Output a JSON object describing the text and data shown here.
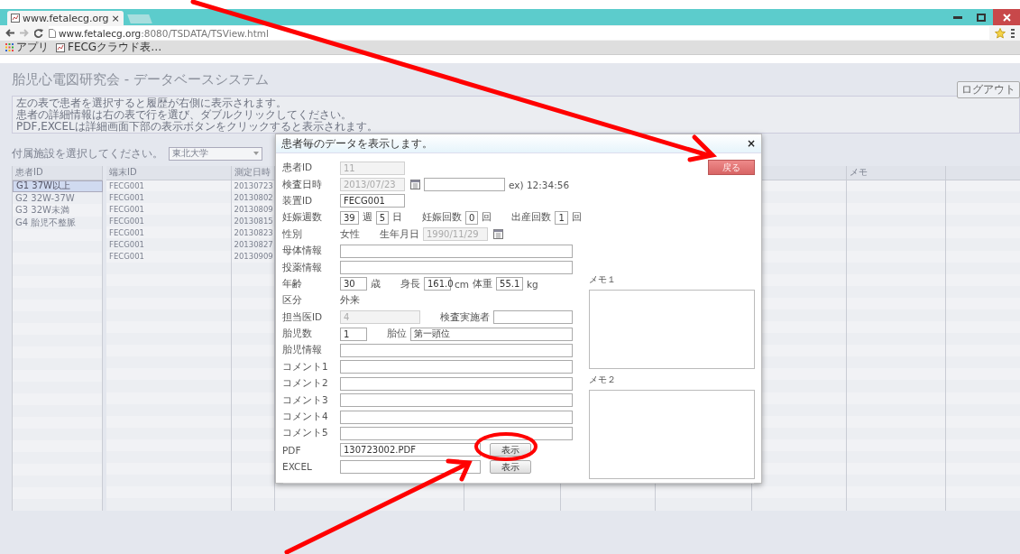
{
  "browser": {
    "tab_title": "www.fetalecg.org",
    "tab_close": "×",
    "url_host": "www.fetalecg.org",
    "url_path": ":8080/TSDATA/TSView.html",
    "bookmarks": [
      "アプリ",
      "FECGクラウド表…"
    ]
  },
  "page": {
    "title": "胎児心電図研究会 - データベースシステム",
    "logout": "ログアウト",
    "info_lines": [
      "左の表で患者を選択すると履歴が右側に表示されます。",
      "患者の詳細情報は右の表で行を選び、ダブルクリックしてください。",
      "PDF,EXCELは詳細画面下部の表示ボタンをクリックすると表示されます。"
    ],
    "facility_label": "付属施設を選択してください。",
    "facility_value": "東北大学",
    "patients": {
      "column": "患者ID",
      "rows": [
        {
          "label": "G1 37W以上",
          "selected": true
        },
        {
          "label": "G2 32W-37W",
          "selected": false
        },
        {
          "label": "G3 32W未満",
          "selected": false
        },
        {
          "label": "G4 胎児不整脈",
          "selected": false
        }
      ]
    },
    "records": {
      "columns": [
        "端末ID",
        "測定日時"
      ],
      "last_column": "メモ",
      "rows": [
        [
          "FECG001",
          "20130723"
        ],
        [
          "FECG001",
          "20130802"
        ],
        [
          "FECG001",
          "20130809"
        ],
        [
          "FECG001",
          "20130815"
        ],
        [
          "FECG001",
          "20130823"
        ],
        [
          "FECG001",
          "20130827"
        ],
        [
          "FECG001",
          "20130909"
        ]
      ]
    }
  },
  "dialog": {
    "title": "患者毎のデータを表示します。",
    "close": "×",
    "back_button": "戻る",
    "rows": [
      {
        "label": "患者ID",
        "parts": [
          {
            "kind": "medium",
            "value": "11",
            "disabled": true
          }
        ]
      },
      {
        "label": "検査日時",
        "parts": [
          {
            "kind": "medium",
            "value": "2013/07/23",
            "disabled": true
          },
          {
            "kind": "calendar"
          },
          {
            "kind": "long",
            "disabled": false
          },
          {
            "kind": "text",
            "text": "ex) 12:34:56"
          }
        ]
      },
      {
        "label": "装置ID",
        "parts": [
          {
            "kind": "medium",
            "value": "FECG001",
            "disabled": false
          }
        ]
      },
      {
        "label": "妊娠週数",
        "parts": [
          {
            "kind": "small",
            "value": "39",
            "disabled": false
          },
          {
            "kind": "text",
            "text": "週"
          },
          {
            "kind": "small",
            "value": "5",
            "disabled": false
          },
          {
            "kind": "text",
            "text": "日"
          },
          {
            "kind": "label",
            "text": "妊娠回数"
          },
          {
            "kind": "small",
            "value": "0",
            "disabled": false
          },
          {
            "kind": "text",
            "text": "回"
          },
          {
            "kind": "label",
            "text": "出産回数"
          },
          {
            "kind": "small",
            "value": "1",
            "disabled": false
          },
          {
            "kind": "text",
            "text": "回"
          }
        ]
      },
      {
        "label": "性別",
        "parts": [
          {
            "kind": "text",
            "text": "女性"
          },
          {
            "kind": "label",
            "text": "生年月日"
          },
          {
            "kind": "medium",
            "value": "1990/11/29",
            "disabled": true
          },
          {
            "kind": "calendar"
          }
        ]
      },
      {
        "label": "母体情報",
        "parts": [
          {
            "kind": "wide",
            "disabled": false
          }
        ]
      },
      {
        "label": "投薬情報",
        "parts": [
          {
            "kind": "wide",
            "disabled": false
          }
        ]
      },
      {
        "label": "年齢",
        "parts": [
          {
            "kind": "small",
            "value": "30",
            "disabled": false
          },
          {
            "kind": "text",
            "text": "歳"
          },
          {
            "kind": "label",
            "text": "身長"
          },
          {
            "kind": "small",
            "value": "161.0",
            "disabled": false
          },
          {
            "kind": "text",
            "text": "cm"
          },
          {
            "kind": "text",
            "text": "体重"
          },
          {
            "kind": "small",
            "value": "55.1",
            "disabled": false
          },
          {
            "kind": "text",
            "text": "kg"
          }
        ]
      },
      {
        "label": "区分",
        "parts": [
          {
            "kind": "text",
            "text": "外来"
          }
        ]
      },
      {
        "label": "担当医ID",
        "parts": [
          {
            "kind": "long",
            "value": "4",
            "disabled": true
          },
          {
            "kind": "label",
            "text": "検査実施者"
          },
          {
            "kind": "long",
            "disabled": false
          }
        ]
      },
      {
        "label": "胎児数",
        "parts": [
          {
            "kind": "small",
            "value": "1",
            "disabled": false
          },
          {
            "kind": "label",
            "text": "胎位"
          },
          {
            "kind": "wide",
            "value": "第一頭位",
            "disabled": false
          }
        ]
      },
      {
        "label": "胎児情報",
        "parts": [
          {
            "kind": "wide",
            "disabled": false
          }
        ]
      },
      {
        "label": "コメント1",
        "parts": [
          {
            "kind": "wide",
            "disabled": false
          }
        ]
      },
      {
        "label": "コメント2",
        "parts": [
          {
            "kind": "wide",
            "disabled": false
          }
        ]
      },
      {
        "label": "コメント3",
        "parts": [
          {
            "kind": "wide",
            "disabled": false
          }
        ]
      },
      {
        "label": "コメント4",
        "parts": [
          {
            "kind": "wide",
            "disabled": false
          }
        ]
      },
      {
        "label": "コメント5",
        "parts": [
          {
            "kind": "wide",
            "disabled": false
          }
        ]
      },
      {
        "label": "PDF",
        "parts": [
          {
            "kind": "file",
            "value": "130723002.PDF",
            "disabled": false
          },
          {
            "kind": "button",
            "text": "表示"
          }
        ]
      },
      {
        "label": "EXCEL",
        "parts": [
          {
            "kind": "file",
            "disabled": false
          },
          {
            "kind": "button",
            "text": "表示"
          }
        ]
      }
    ],
    "memos": [
      {
        "label": "メモ１"
      },
      {
        "label": "メモ２"
      }
    ]
  }
}
